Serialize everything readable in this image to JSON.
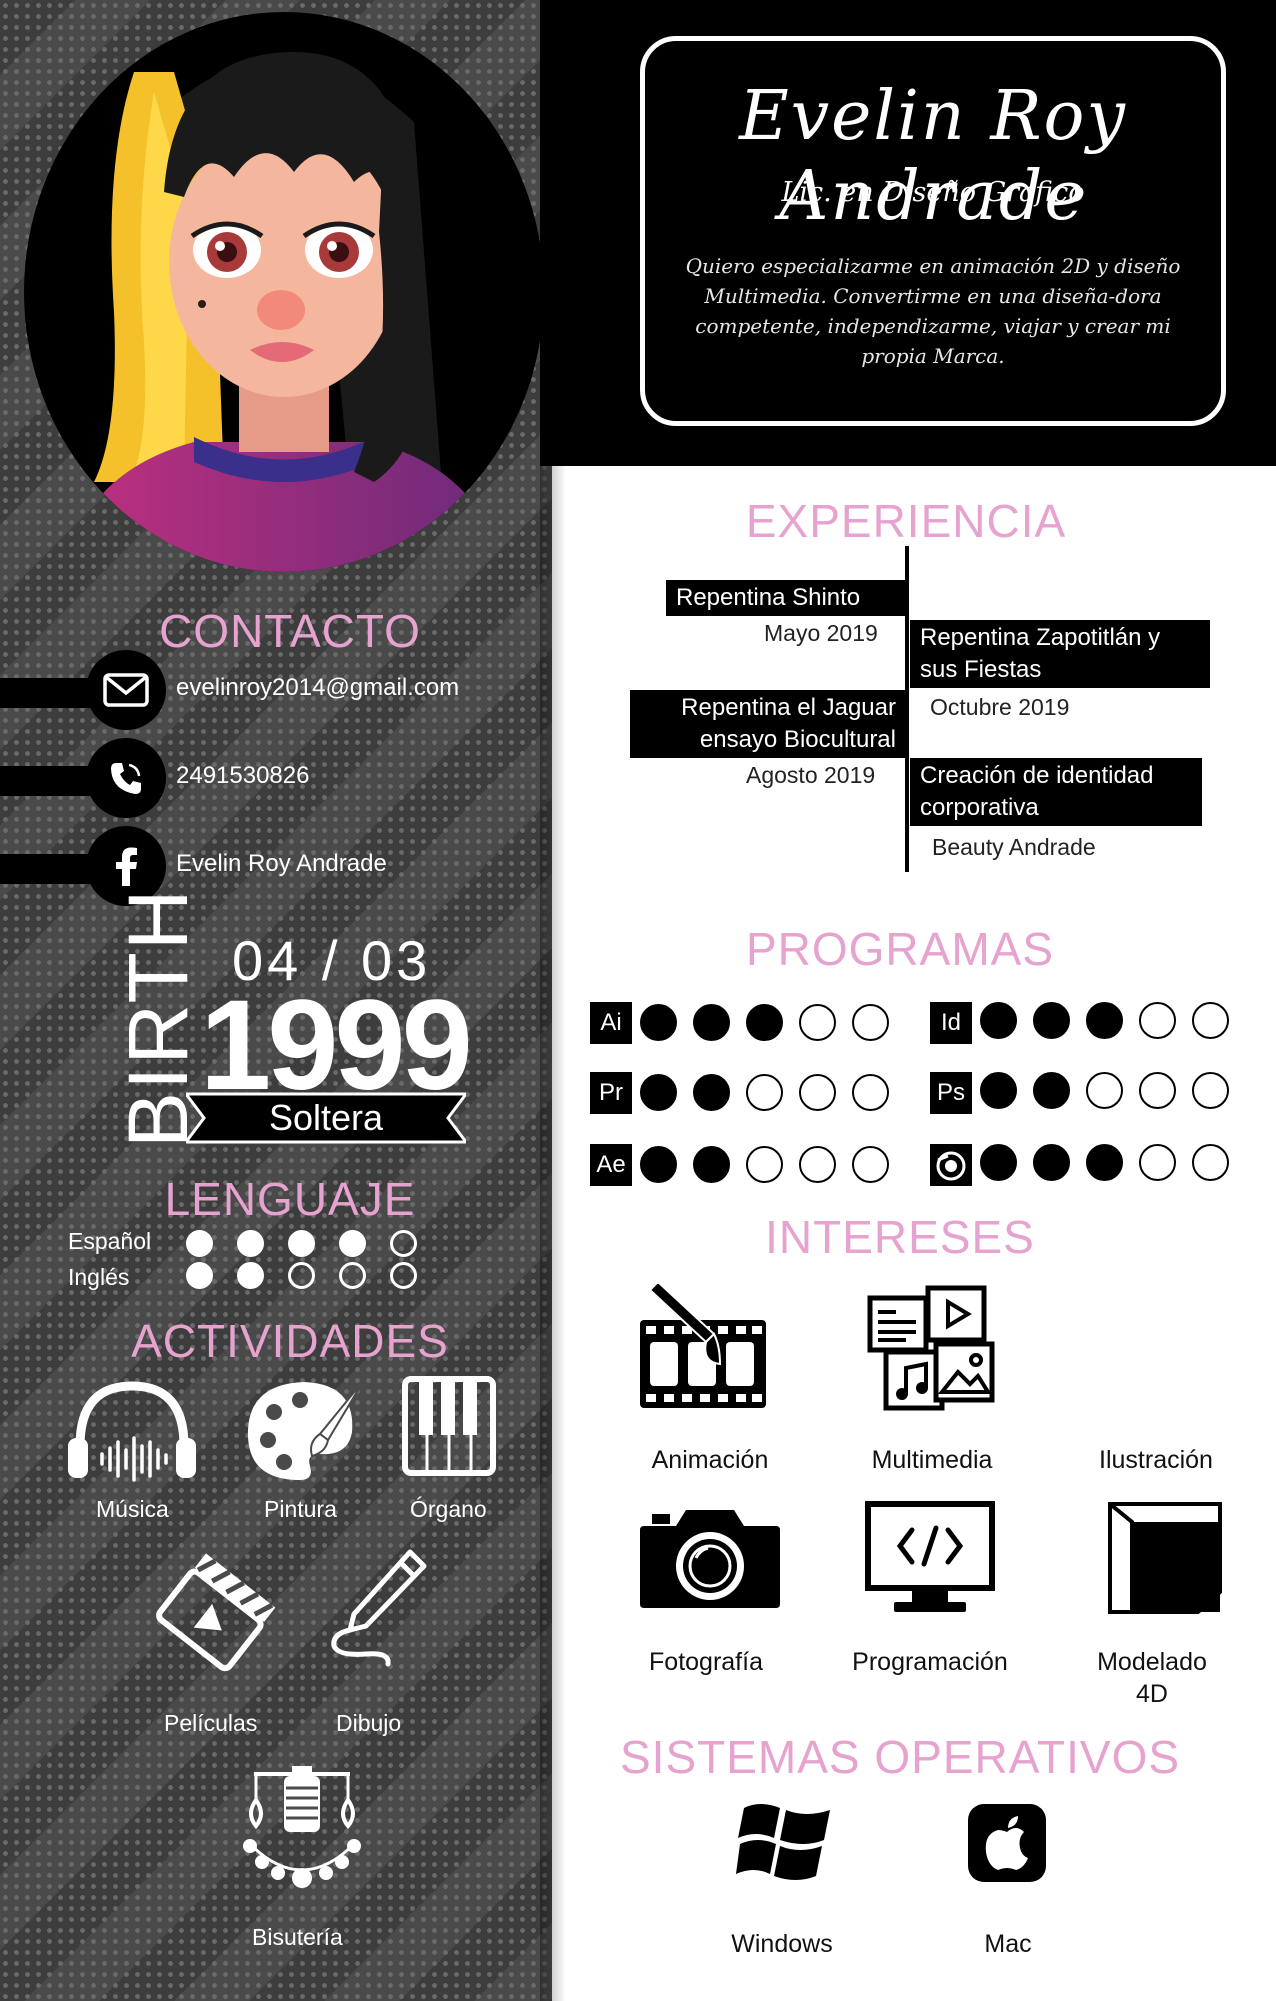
{
  "header": {
    "name": "Evelin Roy Andrade",
    "degree": "Lic. en Diseño Grafico",
    "objective": "Quiero especializarme en animación 2D y diseño Multimedia. Convertirme en una diseña-dora competente, independizarme, viajar y crear mi propia Marca."
  },
  "colors": {
    "accent_pink": "#e6a3cf",
    "panel_gray": "#4a4a4a",
    "black": "#000000"
  },
  "contact": {
    "heading": "CONTACTO",
    "items": [
      {
        "icon": "mail-icon",
        "value": "evelinroy2014@gmail.com"
      },
      {
        "icon": "phone-icon",
        "value": "2491530826"
      },
      {
        "icon": "facebook-icon",
        "value": "Evelin Roy Andrade"
      }
    ]
  },
  "birth": {
    "label": "BIRTH",
    "day_month": "04 / 03",
    "year": "1999",
    "status": "Soltera"
  },
  "languages": {
    "heading": "LENGUAJE",
    "items": [
      {
        "name": "Español",
        "level": 4,
        "max": 5
      },
      {
        "name": "Inglés",
        "level": 2,
        "max": 5
      }
    ]
  },
  "activities": {
    "heading": "ACTIVIDADES",
    "items": [
      {
        "label": "Música",
        "icon": "headphones-icon"
      },
      {
        "label": "Pintura",
        "icon": "palette-icon"
      },
      {
        "label": "Órgano",
        "icon": "piano-keys-icon"
      },
      {
        "label": "Películas",
        "icon": "clapperboard-icon"
      },
      {
        "label": "Dibujo",
        "icon": "pencil-icon"
      },
      {
        "label": "Bisutería",
        "icon": "jewelry-icon"
      }
    ]
  },
  "experience": {
    "heading": "EXPERIENCIA",
    "items": [
      {
        "title": "Repentina Shinto",
        "detail": "Mayo 2019"
      },
      {
        "title": "Repentina Zapotitlán y sus Fiestas",
        "detail": "Octubre 2019"
      },
      {
        "title": "Repentina el Jaguar ensayo Biocultural",
        "detail": "Agosto 2019"
      },
      {
        "title": "Creación de identidad corporativa",
        "detail": "Beauty Andrade"
      }
    ]
  },
  "programs": {
    "heading": "PROGRAMAS",
    "items": [
      {
        "abbr": "Ai",
        "level": 3,
        "max": 5
      },
      {
        "abbr": "Id",
        "level": 3,
        "max": 5
      },
      {
        "abbr": "Pr",
        "level": 2,
        "max": 5
      },
      {
        "abbr": "Ps",
        "level": 2,
        "max": 5
      },
      {
        "abbr": "Ae",
        "level": 2,
        "max": 5
      },
      {
        "abbr": "",
        "icon": "blender-icon",
        "level": 3,
        "max": 5
      }
    ]
  },
  "interests": {
    "heading": "INTERESES",
    "items": [
      {
        "label": "Animación",
        "icon": "film-strip-icon"
      },
      {
        "label": "Multimedia",
        "icon": "multimedia-icon"
      },
      {
        "label": "Ilustración",
        "icon": ""
      },
      {
        "label": "Fotografía",
        "icon": "camera-icon"
      },
      {
        "label": "Programación",
        "icon": "code-monitor-icon"
      },
      {
        "label_line1": "Modelado",
        "label_line2": "4D",
        "icon": "cube-icon"
      }
    ]
  },
  "os": {
    "heading": "SISTEMAS OPERATIVOS",
    "items": [
      {
        "label": "Windows",
        "icon": "windows-icon"
      },
      {
        "label": "Mac",
        "icon": "apple-icon"
      }
    ]
  }
}
